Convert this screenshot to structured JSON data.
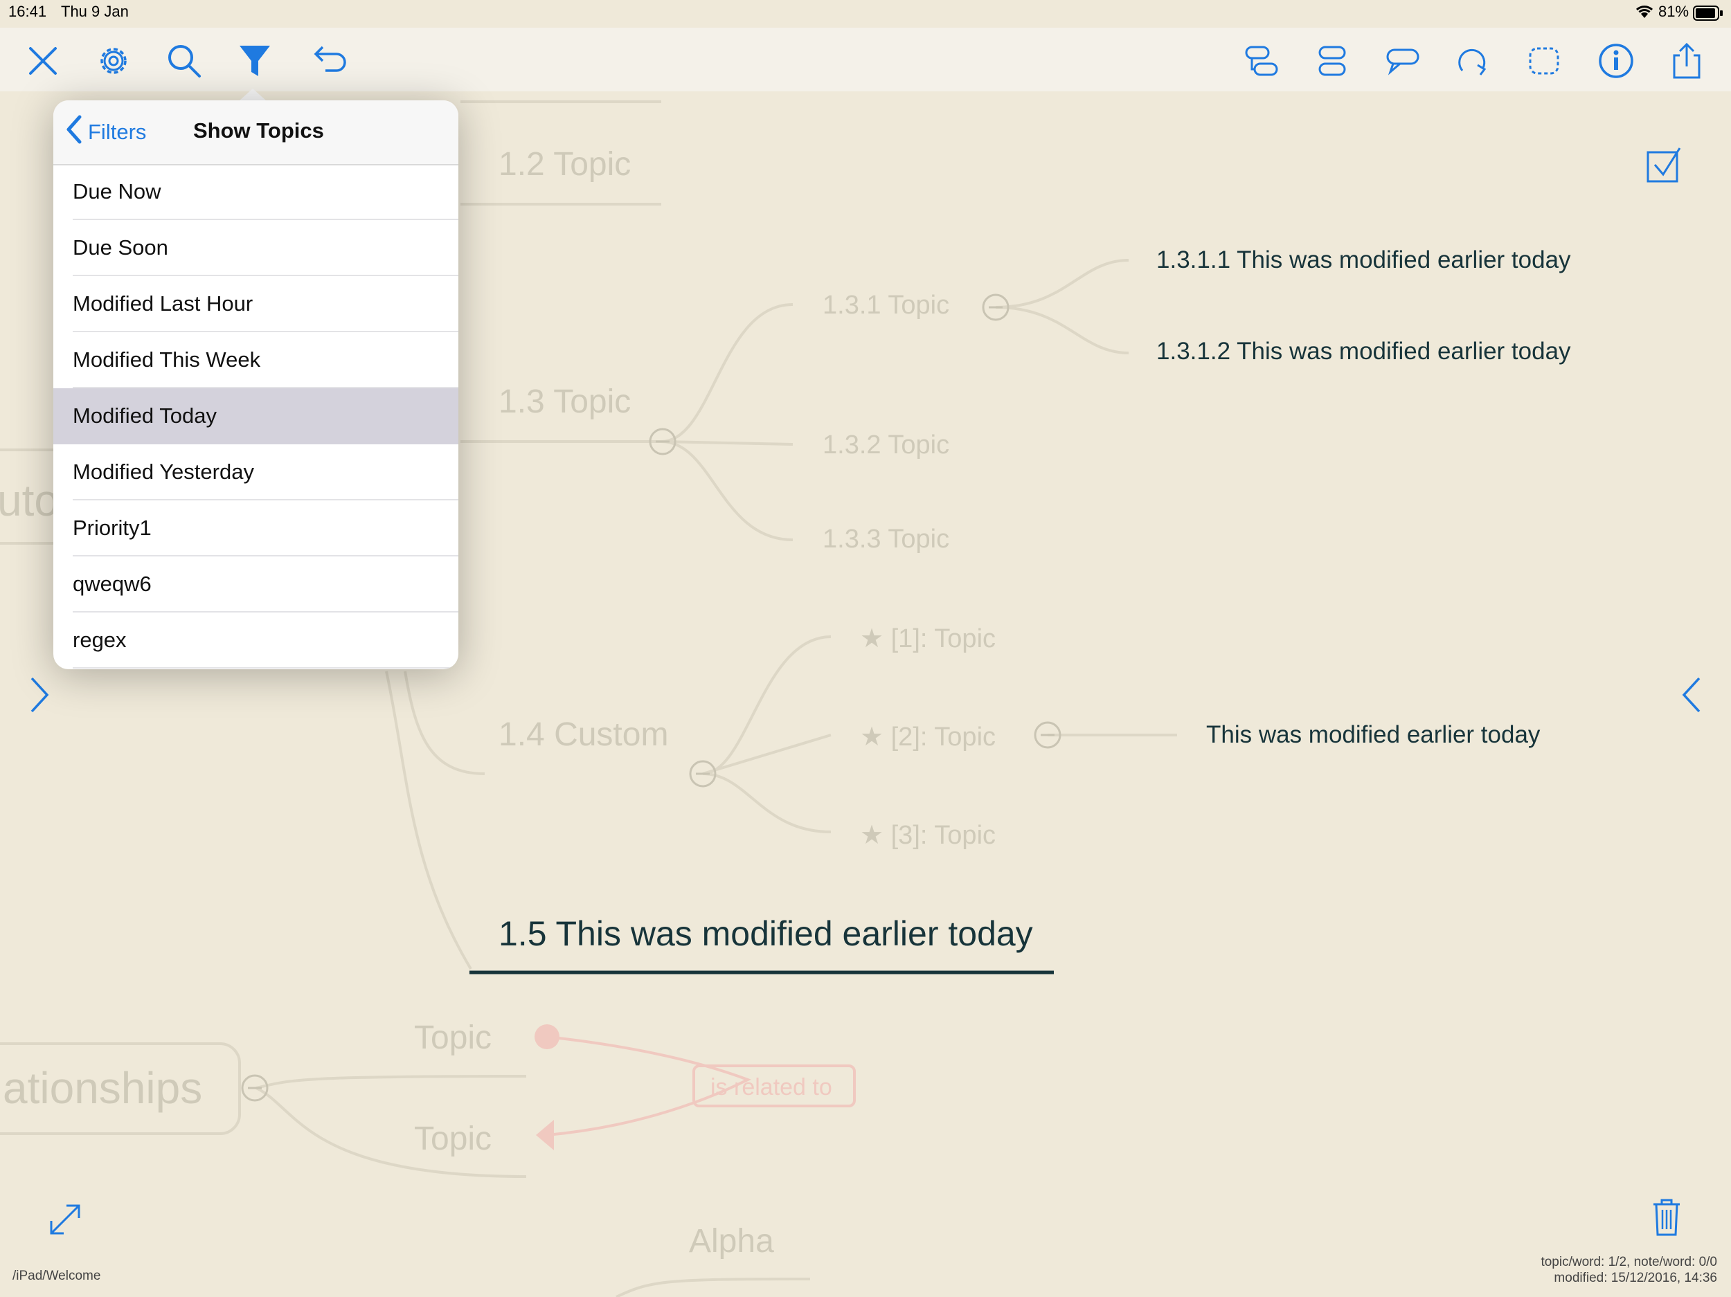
{
  "status": {
    "time": "16:41",
    "date": "Thu 9 Jan",
    "battery": "81%"
  },
  "toolbar": {
    "left_icons": [
      "close-icon",
      "gear-icon",
      "search-icon",
      "filter-icon",
      "undo-icon"
    ],
    "right_icons": [
      "add-subtopic-icon",
      "add-sibling-icon",
      "callout-icon",
      "relationship-icon",
      "boundary-icon",
      "info-icon",
      "share-icon"
    ],
    "accent": "#1f7ae0"
  },
  "popover": {
    "back_label": "Filters",
    "title": "Show Topics",
    "items": [
      {
        "label": "Due Now"
      },
      {
        "label": "Due Soon"
      },
      {
        "label": "Modified Last Hour"
      },
      {
        "label": "Modified This Week"
      },
      {
        "label": "Modified Today",
        "selected": true
      },
      {
        "label": "Modified Yesterday"
      },
      {
        "label": "Priority1"
      },
      {
        "label": "qweqw6"
      },
      {
        "label": "regex"
      }
    ]
  },
  "mindmap": {
    "topic_1_2": "1.2 Topic",
    "topic_1_3": "1.3 Topic",
    "topic_1_3_1": "1.3.1 Topic",
    "topic_1_3_1_1": "1.3.1.1 This was modified earlier today",
    "topic_1_3_1_2": "1.3.1.2 This was modified earlier today",
    "topic_1_3_2": "1.3.2 Topic",
    "topic_1_3_3": "1.3.3 Topic",
    "topic_1_4": "1.4 Custom",
    "custom_1": "[1]: Topic",
    "custom_2": "[2]: Topic",
    "custom_3": "[3]: Topic",
    "custom_2_child": "This was modified earlier today",
    "topic_1_5": "1.5 This was modified earlier today",
    "left_partial": "uto",
    "relationships_partial": "ationships",
    "rel_topic_a": "Topic",
    "rel_topic_b": "Topic",
    "rel_label": "is related to",
    "alpha": "Alpha"
  },
  "footer": {
    "path": "/iPad/Welcome",
    "stats_line1": "topic/word: 1/2, note/word: 0/0",
    "stats_line2": "modified: 15/12/2016, 14:36"
  }
}
